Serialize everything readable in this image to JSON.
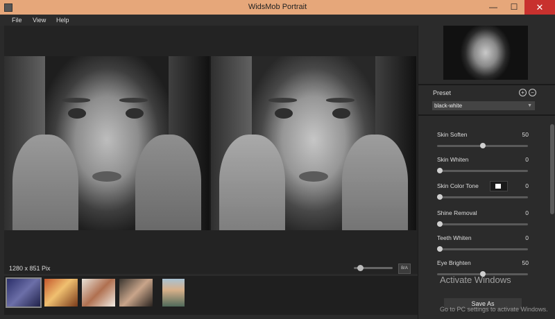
{
  "window": {
    "title": "WidsMob Portrait",
    "close": "✕",
    "maximize": "☐",
    "minimize": "—"
  },
  "menu": [
    "File",
    "View",
    "Help"
  ],
  "viewer": {
    "resolution": "1280 x 851 Pix",
    "ba_label": "B/A",
    "zoom_level": 0.1
  },
  "filmstrip": {
    "count": 5,
    "selected_index": 0
  },
  "sidebar": {
    "preset_label": "Preset",
    "preset_value": "black-white",
    "sliders": [
      {
        "label": "Skin Soften",
        "value": "50",
        "fraction": 0.5
      },
      {
        "label": "Skin Whiten",
        "value": "0",
        "fraction": 0
      },
      {
        "label": "Skin Color Tone",
        "value": "0",
        "fraction": 0,
        "swatch": "#ffffff"
      },
      {
        "label": "Shine Removal",
        "value": "0",
        "fraction": 0
      },
      {
        "label": "Teeth Whiten",
        "value": "0",
        "fraction": 0
      },
      {
        "label": "Eye Brighten",
        "value": "50",
        "fraction": 0.5
      }
    ],
    "save_label": "Save As"
  },
  "watermark": {
    "title": "Activate Windows",
    "subtitle": "Go to PC settings to activate Windows."
  },
  "colors": {
    "titlebar": "#e6a77a",
    "close": "#c8312e",
    "background": "#2a2a2a"
  }
}
